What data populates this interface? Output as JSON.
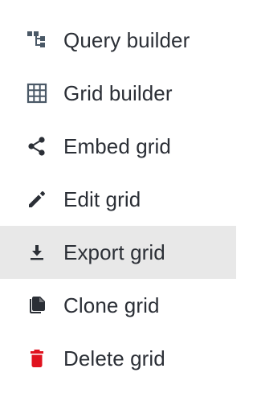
{
  "menu": {
    "items": [
      {
        "label": "Query builder",
        "icon": "query-builder-icon",
        "icon_color": "#4a5866"
      },
      {
        "label": "Grid builder",
        "icon": "grid-icon",
        "icon_color": "#4a5866"
      },
      {
        "label": "Embed grid",
        "icon": "share-icon",
        "icon_color": "#2b2f36"
      },
      {
        "label": "Edit grid",
        "icon": "pencil-icon",
        "icon_color": "#2b2f36"
      },
      {
        "label": "Export grid",
        "icon": "download-icon",
        "icon_color": "#2b2f36",
        "highlighted": true
      },
      {
        "label": "Clone grid",
        "icon": "copy-icon",
        "icon_color": "#2b2f36"
      },
      {
        "label": "Delete grid",
        "icon": "trash-icon",
        "icon_color": "#e0131f"
      }
    ]
  },
  "colors": {
    "text": "#2b2f36",
    "highlight_background": "#e8e8e8",
    "danger": "#e0131f"
  }
}
